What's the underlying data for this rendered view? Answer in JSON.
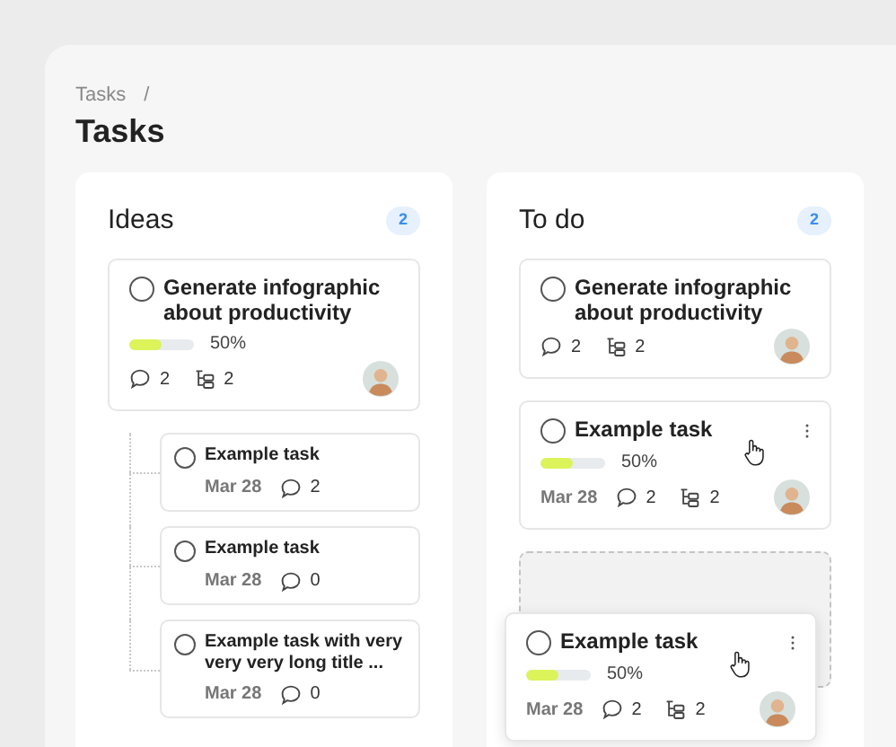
{
  "breadcrumb": {
    "items": [
      "Tasks"
    ],
    "separator": "/"
  },
  "title": "Tasks",
  "columns": [
    {
      "title": "Ideas",
      "count": "2",
      "cards": [
        {
          "title": "Generate infographic about productivity",
          "checked": false,
          "level": 0.5,
          "progress": "50%",
          "comments": "2",
          "subtasks": "2",
          "children": [
            {
              "title": "Example task",
              "checked": false,
              "date": "Mar 28",
              "comments": "2"
            },
            {
              "title": "Example task",
              "checked": false,
              "date": "Mar 28",
              "comments": "0"
            },
            {
              "title": "Example task with very very very long title ...",
              "checked": false,
              "date": "Mar 28",
              "comments": "0"
            }
          ]
        }
      ]
    },
    {
      "title": "To do",
      "count": "2",
      "drop_placeholder": true,
      "cards": [
        {
          "title": "Generate infographic about productivity",
          "checked": false,
          "comments": "2",
          "subtasks": "2"
        },
        {
          "title": "Example task",
          "checked": false,
          "level": 0.5,
          "progress": "50%",
          "date": "Mar 28",
          "comments": "2",
          "subtasks": "2",
          "menu": true,
          "hovered": true
        }
      ]
    }
  ],
  "dragging": {
    "title": "Example task",
    "checked": false,
    "level": 0.5,
    "progress": "50%",
    "date": "Mar 28",
    "comments": "2",
    "subtasks": "2",
    "menu": true,
    "hovered": true
  }
}
